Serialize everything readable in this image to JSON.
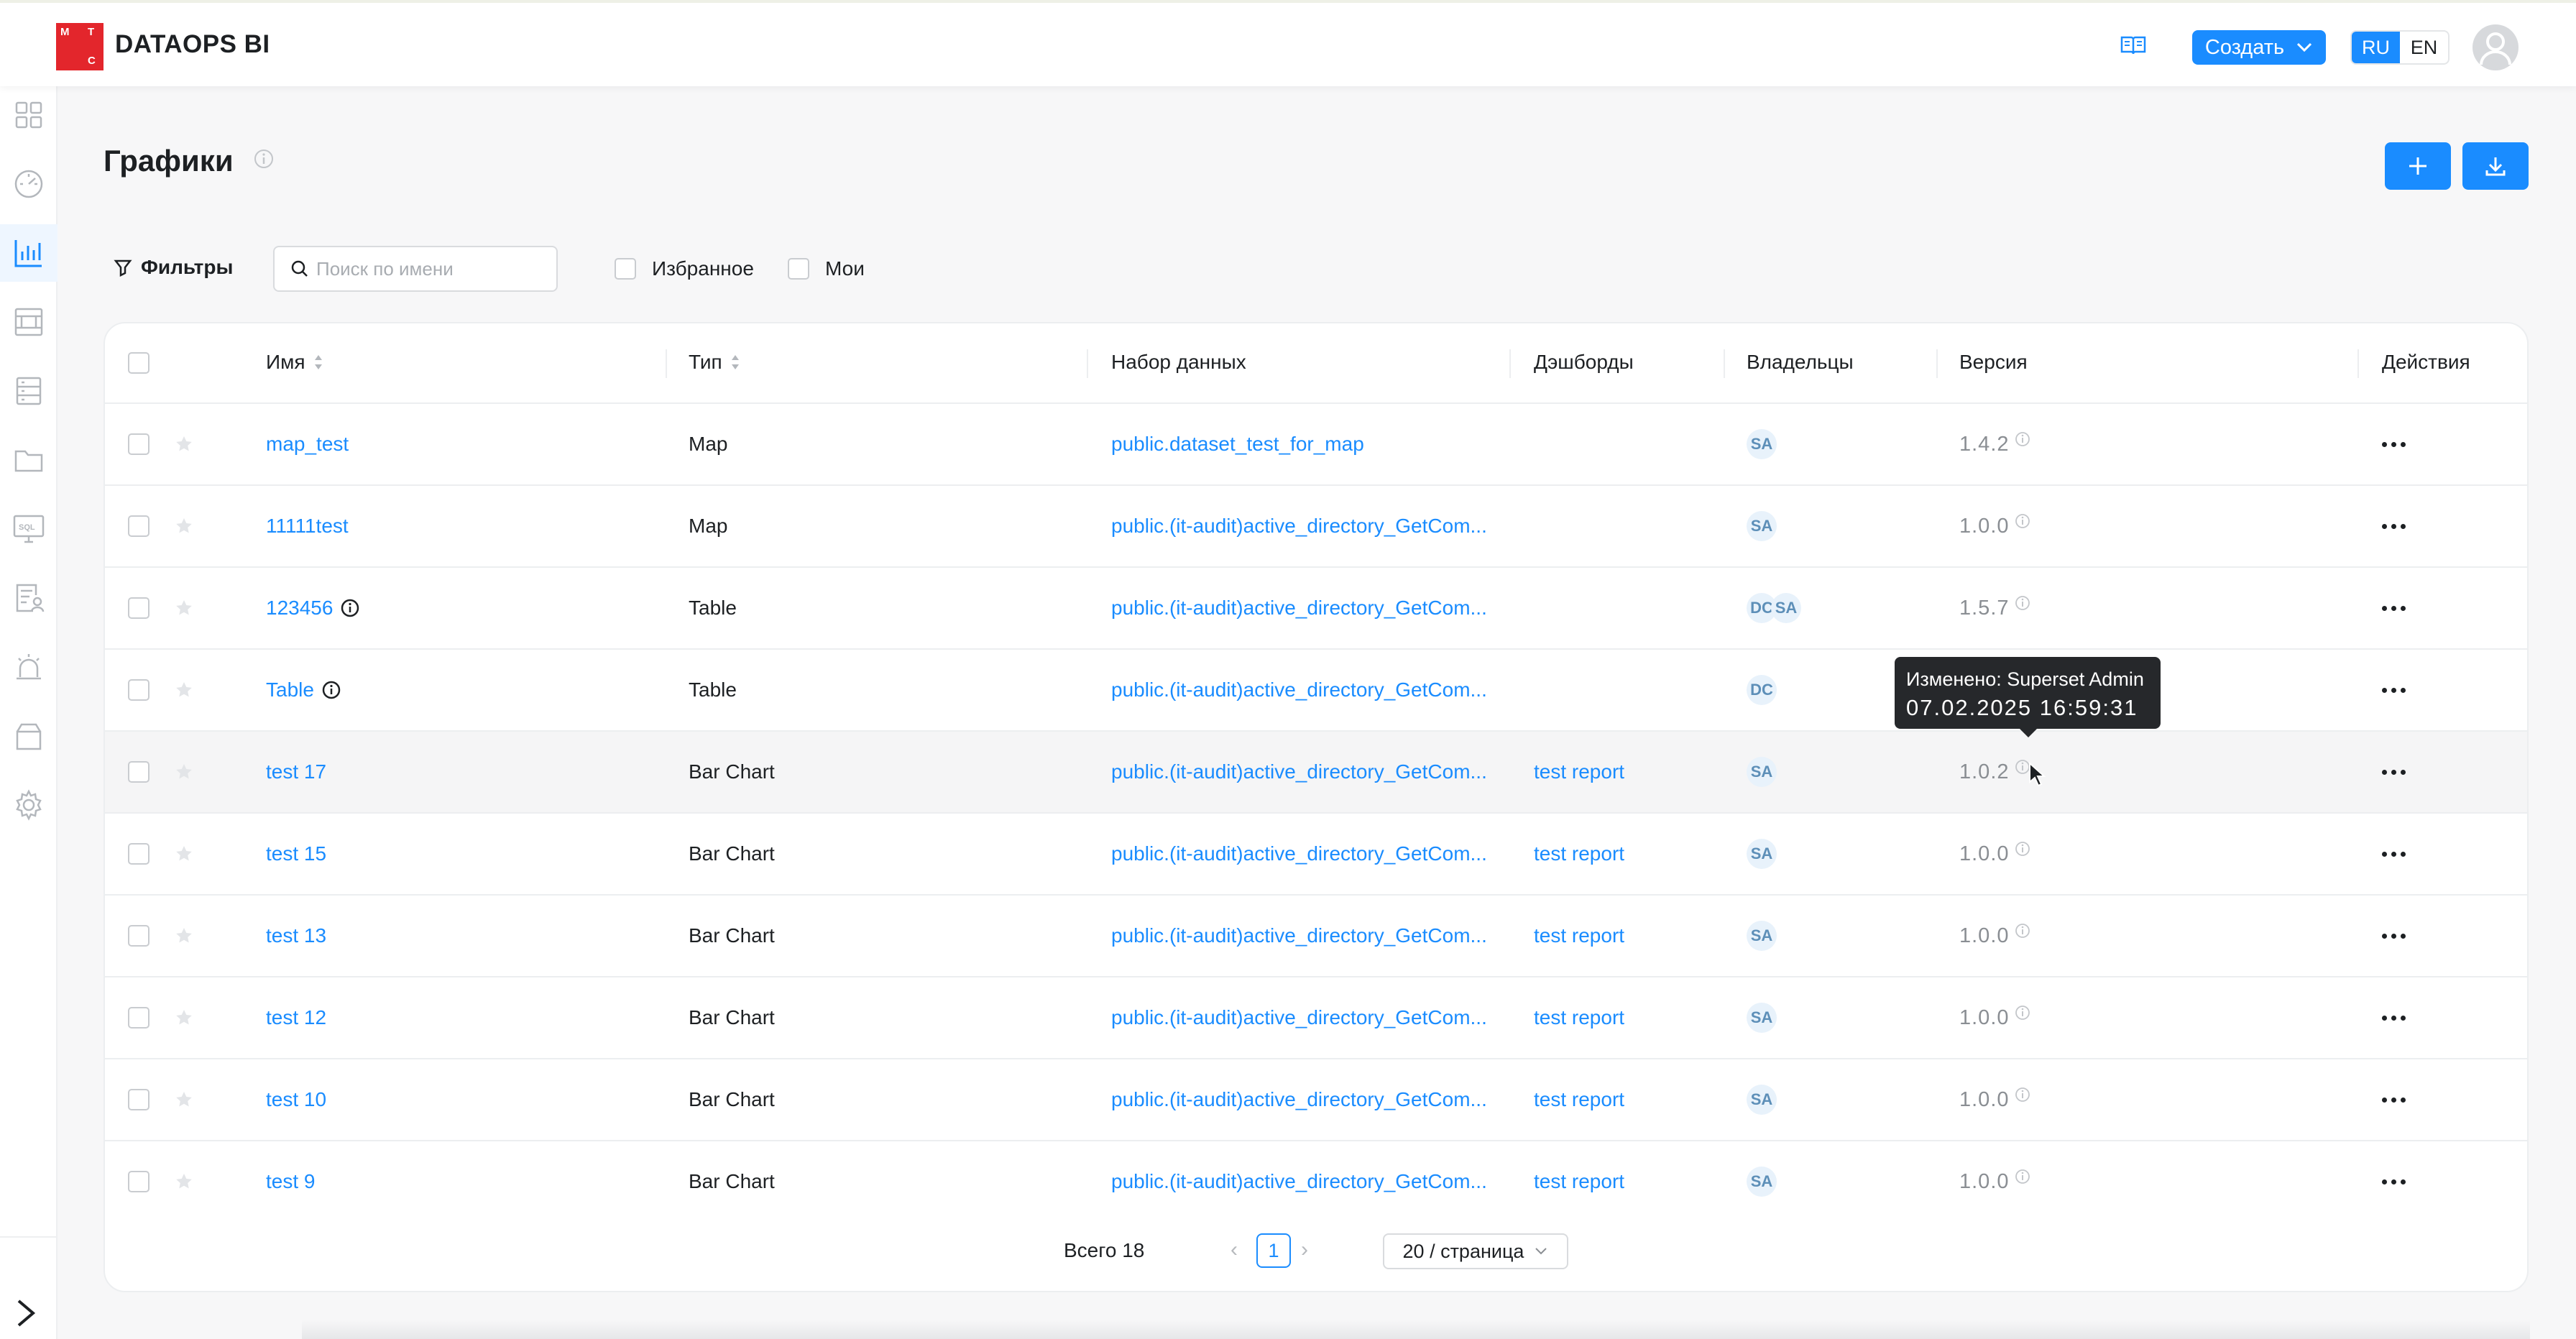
{
  "header": {
    "logo_letters": [
      "М",
      "Т",
      "С"
    ],
    "app_title": "DATAOPS BI",
    "create_label": "Создать",
    "lang_ru": "RU",
    "lang_en": "EN",
    "accent": "#1a8cff"
  },
  "sidebar": {
    "items": [
      {
        "icon": "dashboard-grid-icon"
      },
      {
        "icon": "speedometer-icon"
      },
      {
        "icon": "bar-chart-icon",
        "active": true
      },
      {
        "icon": "datasets-icon"
      },
      {
        "icon": "database-icon"
      },
      {
        "icon": "folder-icon"
      },
      {
        "icon": "sql-monitor-icon",
        "label": "SQL"
      },
      {
        "icon": "user-report-icon"
      },
      {
        "icon": "alarm-icon"
      },
      {
        "icon": "box-icon"
      },
      {
        "icon": "gear-icon"
      }
    ]
  },
  "page": {
    "title": "Графики"
  },
  "filters": {
    "label": "Фильтры",
    "search_placeholder": "Поиск по имени",
    "favorites_label": "Избранное",
    "mine_label": "Мои"
  },
  "table": {
    "columns": [
      "Имя",
      "Тип",
      "Набор данных",
      "Дэшборды",
      "Владельцы",
      "Версия",
      "Действия"
    ],
    "rows": [
      {
        "name": "map_test",
        "info": false,
        "type": "Map",
        "dataset": "public.dataset_test_for_map",
        "dashboard": "",
        "owners": [
          "SA"
        ],
        "version": "1.4.2"
      },
      {
        "name": "11111test",
        "info": false,
        "type": "Map",
        "dataset": "public.(it-audit)active_directory_GetCom...",
        "dashboard": "",
        "owners": [
          "SA"
        ],
        "version": "1.0.0"
      },
      {
        "name": "123456",
        "info": true,
        "type": "Table",
        "dataset": "public.(it-audit)active_directory_GetCom...",
        "dashboard": "",
        "owners": [
          "DC",
          "SA"
        ],
        "version": "1.5.7"
      },
      {
        "name": "Table",
        "info": true,
        "type": "Table",
        "dataset": "public.(it-audit)active_directory_GetCom...",
        "dashboard": "",
        "owners": [
          "DC"
        ],
        "version": ""
      },
      {
        "name": "test 17",
        "info": false,
        "type": "Bar Chart",
        "dataset": "public.(it-audit)active_directory_GetCom...",
        "dashboard": "test report",
        "owners": [
          "SA"
        ],
        "version": "1.0.2"
      },
      {
        "name": "test 15",
        "info": false,
        "type": "Bar Chart",
        "dataset": "public.(it-audit)active_directory_GetCom...",
        "dashboard": "test report",
        "owners": [
          "SA"
        ],
        "version": "1.0.0"
      },
      {
        "name": "test 13",
        "info": false,
        "type": "Bar Chart",
        "dataset": "public.(it-audit)active_directory_GetCom...",
        "dashboard": "test report",
        "owners": [
          "SA"
        ],
        "version": "1.0.0"
      },
      {
        "name": "test 12",
        "info": false,
        "type": "Bar Chart",
        "dataset": "public.(it-audit)active_directory_GetCom...",
        "dashboard": "test report",
        "owners": [
          "SA"
        ],
        "version": "1.0.0"
      },
      {
        "name": "test 10",
        "info": false,
        "type": "Bar Chart",
        "dataset": "public.(it-audit)active_directory_GetCom...",
        "dashboard": "test report",
        "owners": [
          "SA"
        ],
        "version": "1.0.0"
      },
      {
        "name": "test 9",
        "info": false,
        "type": "Bar Chart",
        "dataset": "public.(it-audit)active_directory_GetCom...",
        "dashboard": "test report",
        "owners": [
          "SA"
        ],
        "version": "1.0.0"
      }
    ]
  },
  "pagination": {
    "total_label": "Всего 18",
    "current_page": "1",
    "page_size": "20 / страница"
  },
  "tooltip": {
    "line1": "Изменено: Superset Admin",
    "line2": "07.02.2025 16:59:31"
  }
}
